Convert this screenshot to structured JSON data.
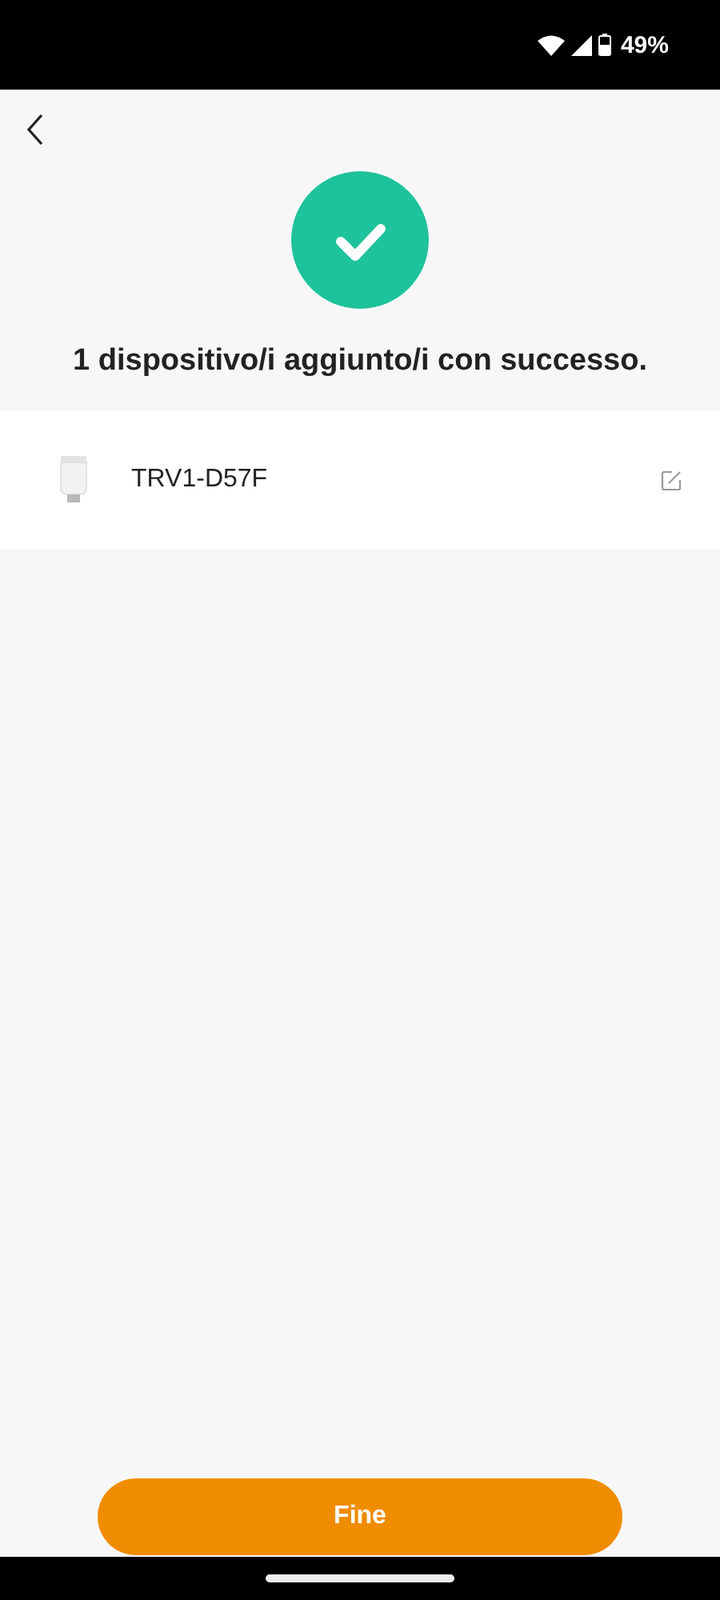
{
  "status_bar": {
    "battery": "49%"
  },
  "title": "1 dispositivo/i aggiunto/i con successo.",
  "devices": [
    {
      "name": "TRV1-D57F"
    }
  ],
  "button": "Fine"
}
